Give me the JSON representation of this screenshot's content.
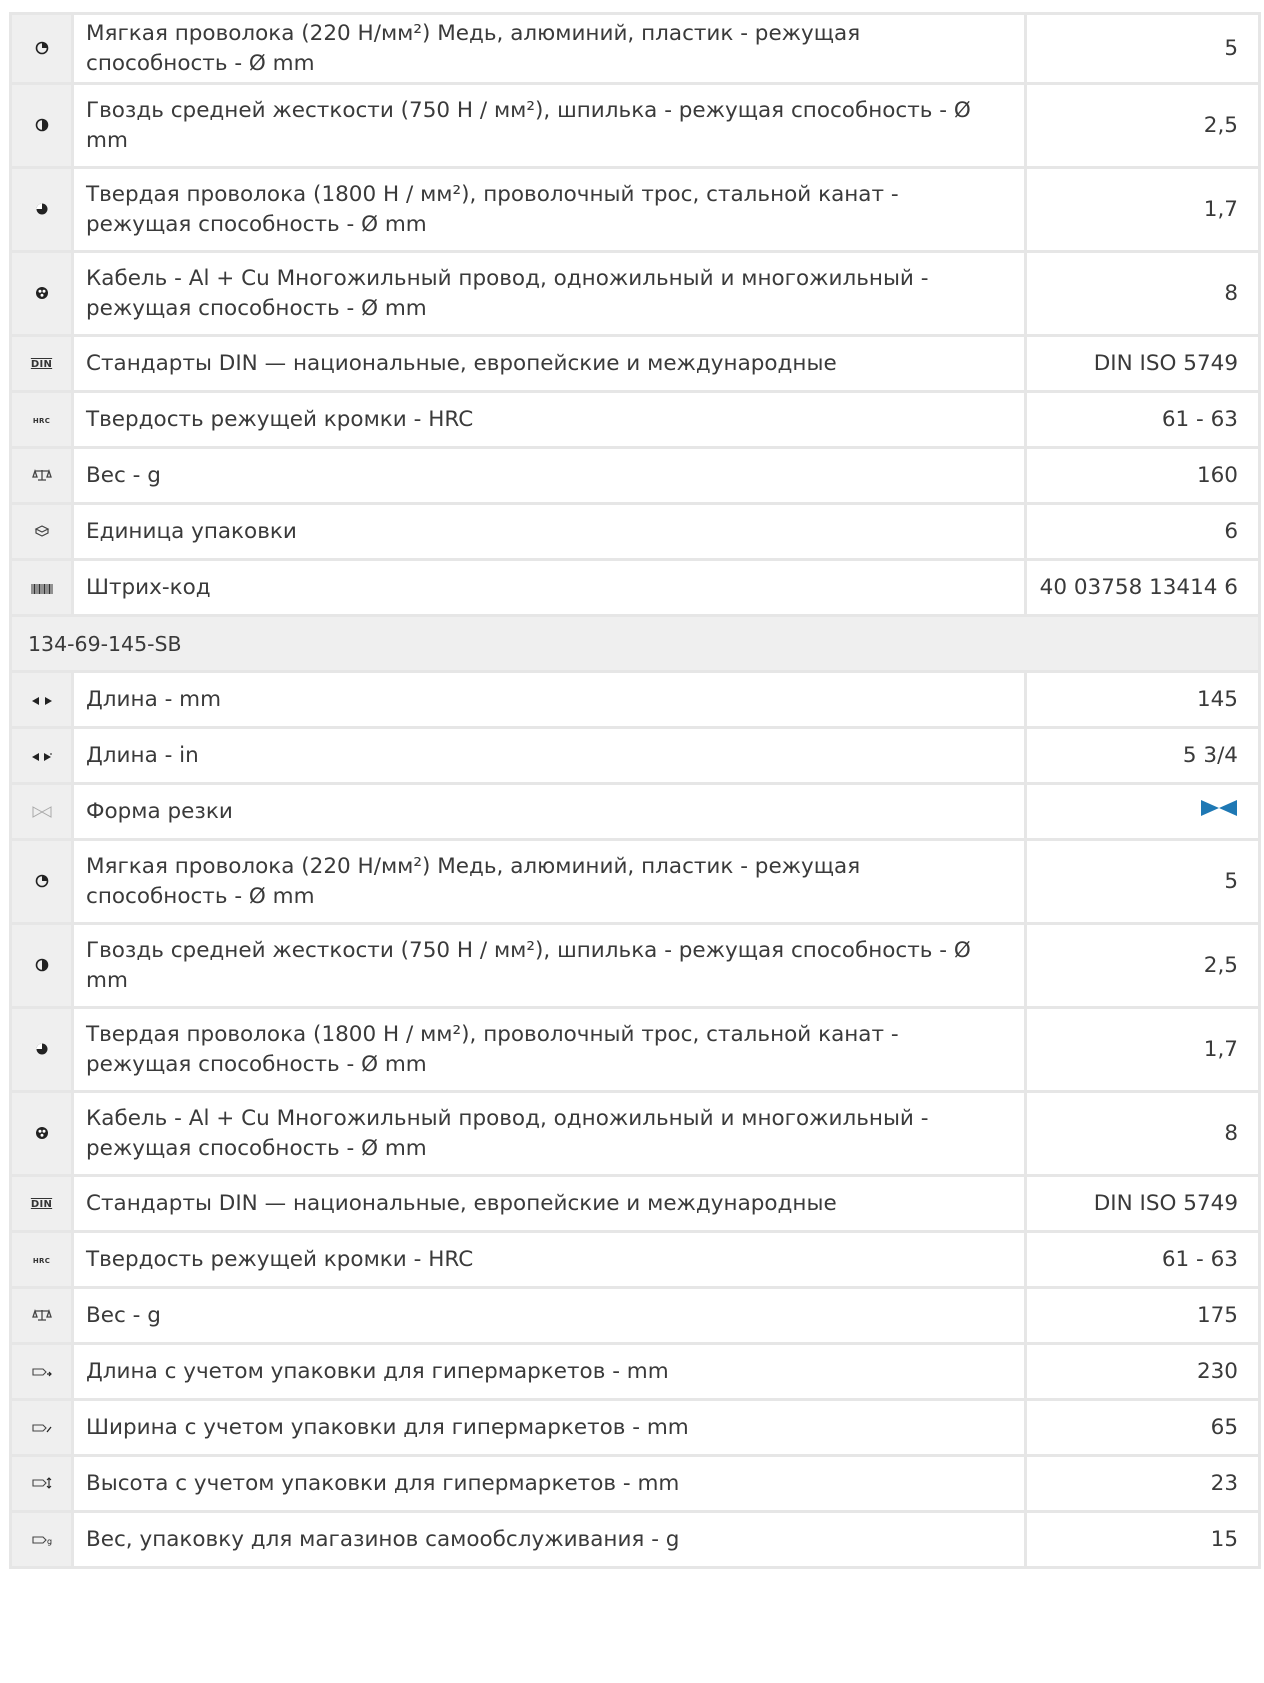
{
  "rows": [
    {
      "type": "spec",
      "icon": "soft-wire-icon",
      "label": "Мягкая проволока (220 Н/мм²) Медь, алюминий, пластик - режущая способность - Ø mm",
      "value": "5"
    },
    {
      "type": "spec",
      "icon": "medium-wire-icon",
      "label": "Гвоздь средней жесткости (750 Н / мм²), шпилька - режущая способность - Ø mm",
      "value": "2,5"
    },
    {
      "type": "spec",
      "icon": "hard-wire-icon",
      "label": "Твердая проволока (1800 Н / мм²), проволочный трос, стальной канат - режущая способность - Ø mm",
      "value": "1,7"
    },
    {
      "type": "spec",
      "icon": "cable-icon",
      "label": "Кабель - Al + Cu Многожильный провод, одножильный и многожильный - режущая способность - Ø mm",
      "value": "8"
    },
    {
      "type": "spec",
      "icon": "din-icon",
      "icon_text": "DIN",
      "label": "Стандарты DIN — национальные, европейские и международные",
      "value": "DIN ISO 5749"
    },
    {
      "type": "spec",
      "icon": "hrc-icon",
      "icon_text": "HRC",
      "label": "Твердость режущей кромки - HRC",
      "value": "61 - 63"
    },
    {
      "type": "spec",
      "icon": "scale-icon",
      "label": "Вес - g",
      "value": "160"
    },
    {
      "type": "spec",
      "icon": "package-icon",
      "label": "Единица упаковки",
      "value": "6"
    },
    {
      "type": "spec",
      "icon": "barcode-icon",
      "label": "Штрих-код",
      "value": "40 03758 13414 6"
    },
    {
      "type": "section",
      "label": "134-69-145-SB"
    },
    {
      "type": "spec",
      "icon": "length-mm-icon",
      "label": "Длина - mm",
      "value": "145"
    },
    {
      "type": "spec",
      "icon": "length-in-icon",
      "label": "Длина - in",
      "value": "5 3/4"
    },
    {
      "type": "spec",
      "icon": "cut-shape-icon",
      "label": "Форма резки",
      "value": "",
      "value_icon": "bevel-cut-icon"
    },
    {
      "type": "spec",
      "icon": "soft-wire-icon",
      "label": "Мягкая проволока (220 Н/мм²) Медь, алюминий, пластик - режущая способность - Ø mm",
      "value": "5"
    },
    {
      "type": "spec",
      "icon": "medium-wire-icon",
      "label": "Гвоздь средней жесткости (750 Н / мм²), шпилька - режущая способность - Ø mm",
      "value": "2,5"
    },
    {
      "type": "spec",
      "icon": "hard-wire-icon",
      "label": "Твердая проволока (1800 Н / мм²), проволочный трос, стальной канат - режущая способность - Ø mm",
      "value": "1,7"
    },
    {
      "type": "spec",
      "icon": "cable-icon",
      "label": "Кабель - Al + Cu Многожильный провод, одножильный и многожильный - режущая способность - Ø mm",
      "value": "8"
    },
    {
      "type": "spec",
      "icon": "din-icon",
      "icon_text": "DIN",
      "label": "Стандарты DIN — национальные, европейские и международные",
      "value": "DIN ISO 5749"
    },
    {
      "type": "spec",
      "icon": "hrc-icon",
      "icon_text": "HRC",
      "label": "Твердость режущей кромки - HRC",
      "value": "61 - 63"
    },
    {
      "type": "spec",
      "icon": "scale-icon",
      "label": "Вес - g",
      "value": "175"
    },
    {
      "type": "spec",
      "icon": "pack-length-icon",
      "label": "Длина с учетом упаковки для гипермаркетов - mm",
      "value": "230"
    },
    {
      "type": "spec",
      "icon": "pack-width-icon",
      "label": "Ширина с учетом упаковки для гипермаркетов - mm",
      "value": "65"
    },
    {
      "type": "spec",
      "icon": "pack-height-icon",
      "label": "Высота с учетом упаковки для гипермаркетов - mm",
      "value": "23"
    },
    {
      "type": "spec",
      "icon": "pack-weight-icon",
      "label": "Вес, упаковку для магазинов самообслуживания - g",
      "value": "15"
    }
  ],
  "colors": {
    "border": "#e6e6e6",
    "icon_cell_bg": "#efefef",
    "text": "#3a3a3a",
    "cut_shape_accent": "#1e78b4"
  }
}
